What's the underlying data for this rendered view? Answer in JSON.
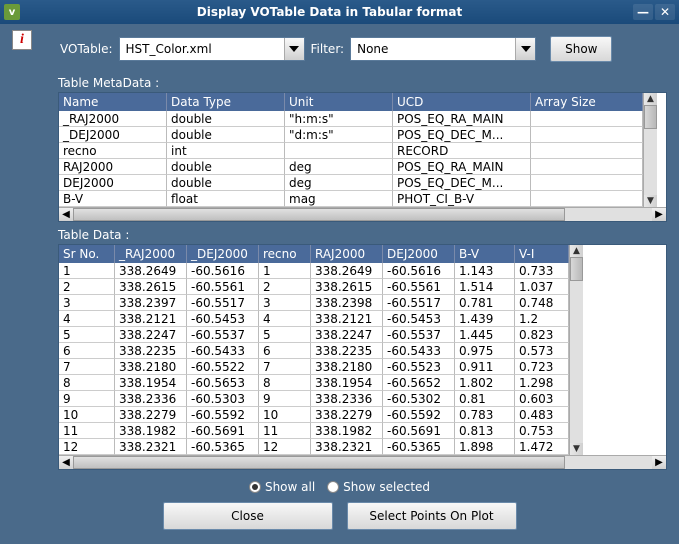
{
  "title": "Display VOTable Data in Tabular format",
  "titlebar_icon": "v",
  "info_icon": "i",
  "labels": {
    "votable": "VOTable:",
    "filter": "Filter:",
    "show": "Show",
    "metadata": "Table MetaData :",
    "tabledata": "Table Data :",
    "show_all": "Show all",
    "show_selected": "Show selected",
    "close": "Close",
    "select_points": "Select Points On Plot"
  },
  "dropdowns": {
    "votable_selected": "HST_Color.xml",
    "filter_selected": "None"
  },
  "radio_state": {
    "show_all": true,
    "show_selected": false
  },
  "meta_columns": [
    "Name",
    "Data Type",
    "Unit",
    "UCD",
    "Array Size"
  ],
  "meta_rows": [
    {
      "name": "_RAJ2000",
      "dtype": "double",
      "unit": "\"h:m:s\"",
      "ucd": "POS_EQ_RA_MAIN",
      "arr": ""
    },
    {
      "name": "_DEJ2000",
      "dtype": "double",
      "unit": "\"d:m:s\"",
      "ucd": "POS_EQ_DEC_M...",
      "arr": ""
    },
    {
      "name": "recno",
      "dtype": "int",
      "unit": "",
      "ucd": "RECORD",
      "arr": ""
    },
    {
      "name": "RAJ2000",
      "dtype": "double",
      "unit": "deg",
      "ucd": "POS_EQ_RA_MAIN",
      "arr": ""
    },
    {
      "name": "DEJ2000",
      "dtype": "double",
      "unit": "deg",
      "ucd": "POS_EQ_DEC_M...",
      "arr": ""
    },
    {
      "name": "B-V",
      "dtype": "float",
      "unit": "mag",
      "ucd": "PHOT_CI_B-V",
      "arr": ""
    }
  ],
  "data_columns": [
    "Sr No.",
    "_RAJ2000",
    "_DEJ2000",
    "recno",
    "RAJ2000",
    "DEJ2000",
    "B-V",
    "V-I"
  ],
  "data_rows": [
    {
      "sr": "1",
      "_ra": "338.2649",
      "_de": "-60.5616",
      "rec": "1",
      "ra": "338.2649",
      "de": "-60.5616",
      "bv": "1.143",
      "vi": "0.733"
    },
    {
      "sr": "2",
      "_ra": "338.2615",
      "_de": "-60.5561",
      "rec": "2",
      "ra": "338.2615",
      "de": "-60.5561",
      "bv": "1.514",
      "vi": "1.037"
    },
    {
      "sr": "3",
      "_ra": "338.2397",
      "_de": "-60.5517",
      "rec": "3",
      "ra": "338.2398",
      "de": "-60.5517",
      "bv": "0.781",
      "vi": "0.748"
    },
    {
      "sr": "4",
      "_ra": "338.2121",
      "_de": "-60.5453",
      "rec": "4",
      "ra": "338.2121",
      "de": "-60.5453",
      "bv": "1.439",
      "vi": "1.2"
    },
    {
      "sr": "5",
      "_ra": "338.2247",
      "_de": "-60.5537",
      "rec": "5",
      "ra": "338.2247",
      "de": "-60.5537",
      "bv": "1.445",
      "vi": "0.823"
    },
    {
      "sr": "6",
      "_ra": "338.2235",
      "_de": "-60.5433",
      "rec": "6",
      "ra": "338.2235",
      "de": "-60.5433",
      "bv": "0.975",
      "vi": "0.573"
    },
    {
      "sr": "7",
      "_ra": "338.2180",
      "_de": "-60.5522",
      "rec": "7",
      "ra": "338.2180",
      "de": "-60.5523",
      "bv": "0.911",
      "vi": "0.723"
    },
    {
      "sr": "8",
      "_ra": "338.1954",
      "_de": "-60.5653",
      "rec": "8",
      "ra": "338.1954",
      "de": "-60.5652",
      "bv": "1.802",
      "vi": "1.298"
    },
    {
      "sr": "9",
      "_ra": "338.2336",
      "_de": "-60.5303",
      "rec": "9",
      "ra": "338.2336",
      "de": "-60.5302",
      "bv": "0.81",
      "vi": "0.603"
    },
    {
      "sr": "10",
      "_ra": "338.2279",
      "_de": "-60.5592",
      "rec": "10",
      "ra": "338.2279",
      "de": "-60.5592",
      "bv": "0.783",
      "vi": "0.483"
    },
    {
      "sr": "11",
      "_ra": "338.1982",
      "_de": "-60.5691",
      "rec": "11",
      "ra": "338.1982",
      "de": "-60.5691",
      "bv": "0.813",
      "vi": "0.753"
    },
    {
      "sr": "12",
      "_ra": "338.2321",
      "_de": "-60.5365",
      "rec": "12",
      "ra": "338.2321",
      "de": "-60.5365",
      "bv": "1.898",
      "vi": "1.472"
    }
  ]
}
